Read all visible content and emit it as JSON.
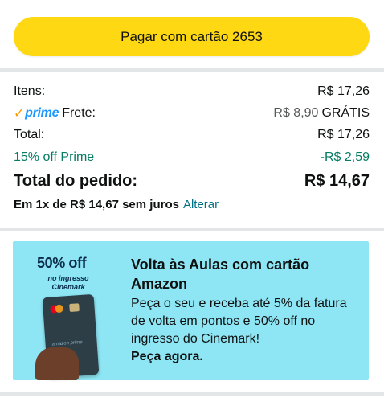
{
  "pay_button": {
    "label": "Pagar com cartão 2653"
  },
  "summary": {
    "items_label": "Itens:",
    "items_value": "R$ 17,26",
    "prime_logo": "prime",
    "shipping_label": "Frete:",
    "shipping_old": "R$ 8,90",
    "shipping_value": "GRÁTIS",
    "total_label": "Total:",
    "total_value": "R$ 17,26",
    "discount_label": "15% off Prime",
    "discount_value": "-R$ 2,59",
    "order_total_label": "Total do pedido:",
    "order_total_value": "R$ 14,67",
    "installment_text": "Em 1x de R$ 14,67 sem juros",
    "change_link": "Alterar"
  },
  "promo": {
    "badge_title": "50% off",
    "badge_subtitle": "no ingresso Cinemark",
    "card_brand": "amazon prime",
    "title": "Volta às Aulas com cartão Amazon",
    "body": "Peça o seu e receba até 5% da fatura de volta em pontos e 50% off no ingresso do Cinemark!",
    "cta": "Peça agora."
  },
  "colors": {
    "button": "#ffd814",
    "promo_bg": "#8ee6f5",
    "green": "#067d62",
    "link": "#007185",
    "prime_blue": "#1a98ff",
    "prime_orange": "#ff9900"
  }
}
